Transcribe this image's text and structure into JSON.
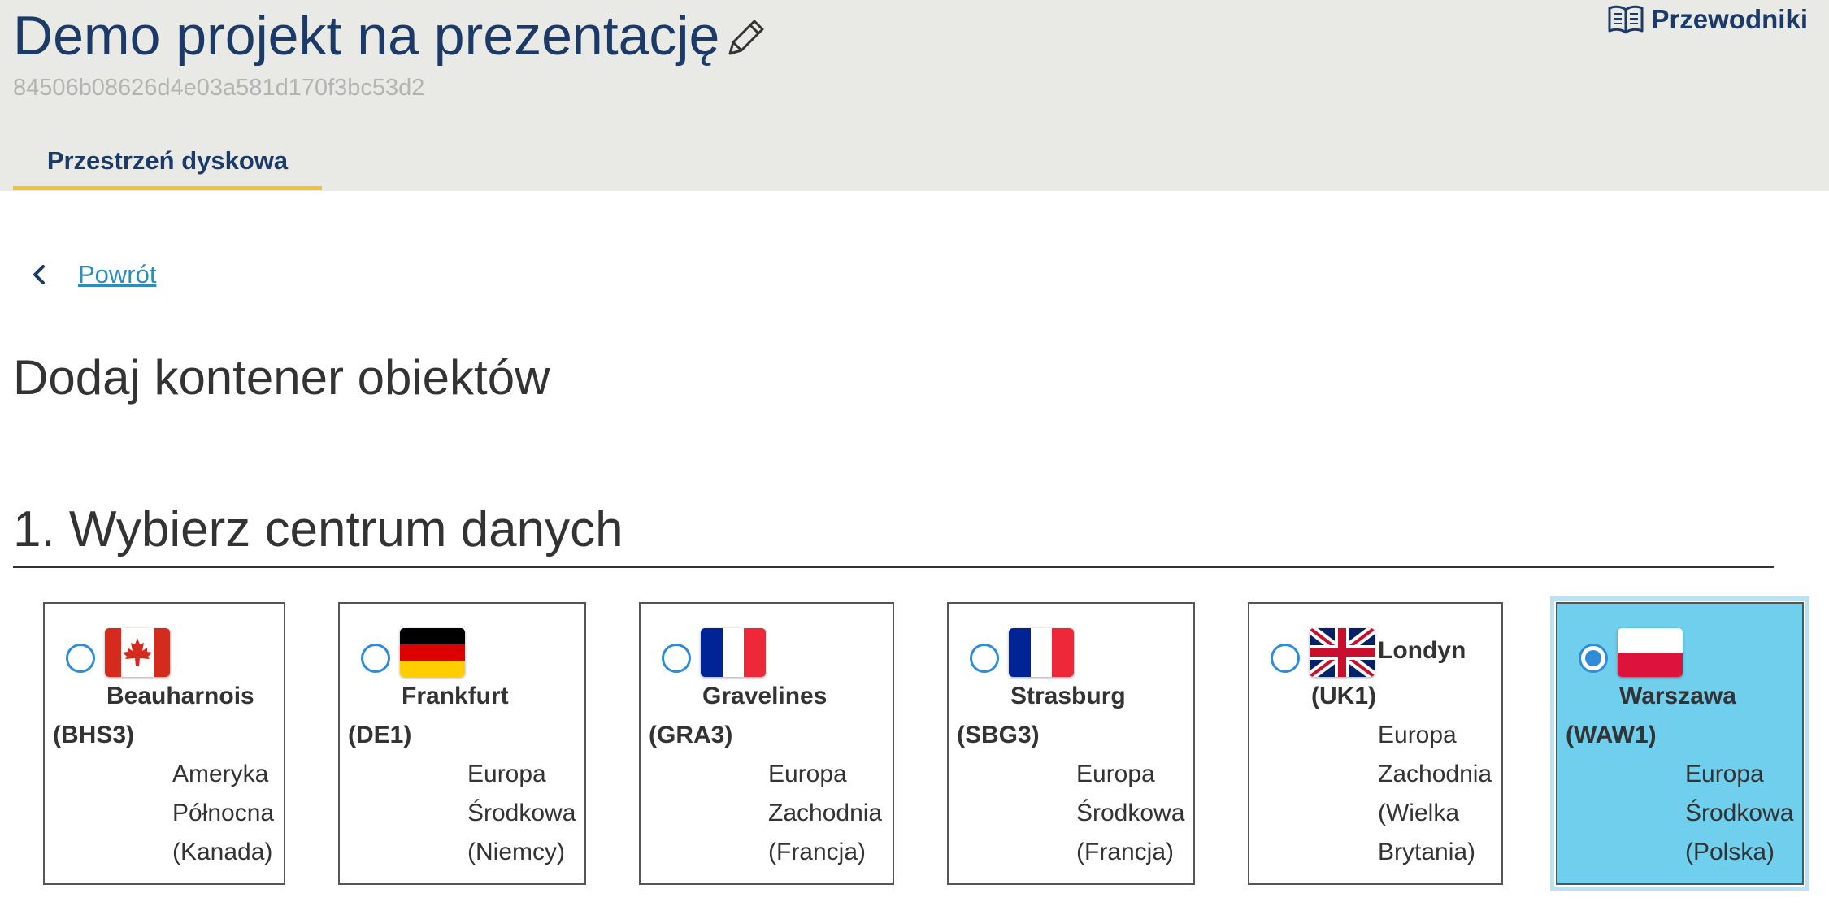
{
  "header": {
    "project_title": "Demo projekt na prezentację",
    "project_id": "84506b08626d4e03a581d170f3bc53d2",
    "guides_label": "Przewodniki",
    "tab_label": "Przestrzeń dyskowa"
  },
  "nav": {
    "back_label": "Powrót"
  },
  "page": {
    "title": "Dodaj kontener obiektów",
    "section_title": "1. Wybierz centrum danych"
  },
  "colors": {
    "accent_navy": "#1b3a67",
    "tab_underline": "#f1c232",
    "link": "#2e8cb8",
    "selected_card": "#6fcfec"
  },
  "datacenters": [
    {
      "name_line1": "Beauharnois",
      "name_line2": "(BHS3)",
      "region_lines": [
        "Ameryka",
        "Północna",
        "(Kanada)"
      ],
      "flag": "canada-flag",
      "selected": false
    },
    {
      "name_line1": "Frankfurt",
      "name_line2": "(DE1)",
      "region_lines": [
        "Europa",
        "Środkowa",
        "(Niemcy)"
      ],
      "flag": "germany-flag",
      "selected": false
    },
    {
      "name_line1": "Gravelines",
      "name_line2": "(GRA3)",
      "region_lines": [
        "Europa",
        "Zachodnia",
        "(Francja)"
      ],
      "flag": "france-flag",
      "selected": false
    },
    {
      "name_line1": "Strasburg",
      "name_line2": "(SBG3)",
      "region_lines": [
        "Europa",
        "Środkowa",
        "(Francja)"
      ],
      "flag": "france-flag",
      "selected": false
    },
    {
      "name_line1": "Londyn",
      "name_line2": "(UK1)",
      "region_lines": [
        "Europa",
        "Zachodnia",
        "(Wielka",
        "Brytania)"
      ],
      "flag": "uk-flag",
      "selected": false
    },
    {
      "name_line1": "Warszawa",
      "name_line2": "(WAW1)",
      "region_lines": [
        "Europa",
        "Środkowa",
        "(Polska)"
      ],
      "flag": "poland-flag",
      "selected": true
    }
  ]
}
